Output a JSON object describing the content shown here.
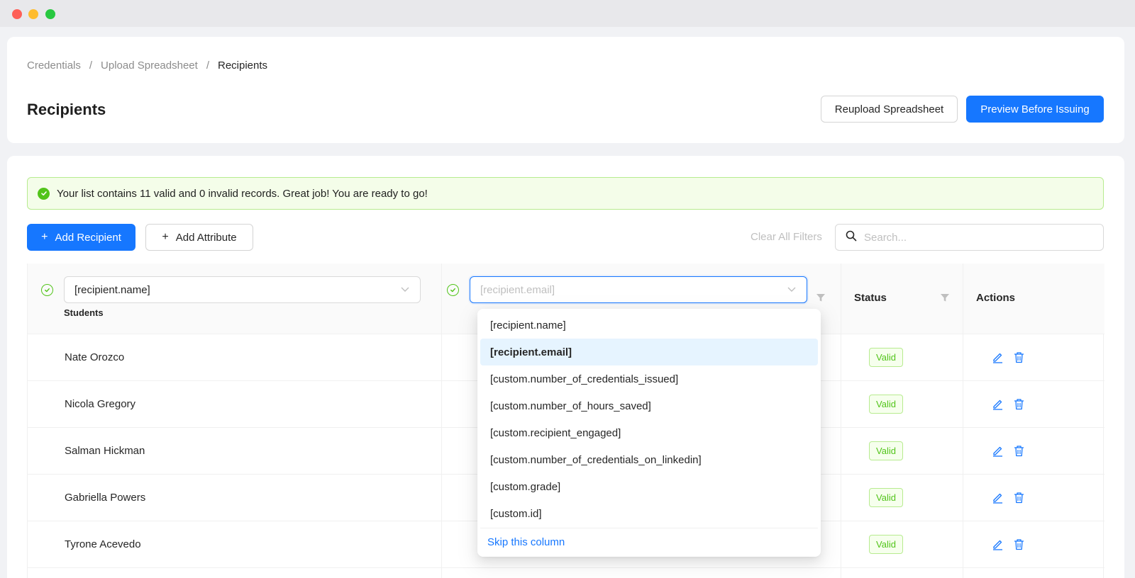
{
  "window": {
    "controls": [
      "close",
      "minimize",
      "zoom"
    ]
  },
  "breadcrumb": {
    "items": [
      "Credentials",
      "Upload Spreadsheet",
      "Recipients"
    ],
    "separator": "/"
  },
  "page": {
    "title": "Recipients"
  },
  "header_buttons": {
    "reupload": "Reupload Spreadsheet",
    "preview": "Preview Before Issuing"
  },
  "alert": {
    "message": "Your list contains 11 valid and 0 invalid records. Great job! You are ready to go!",
    "icon": "check-circle-icon"
  },
  "toolbar": {
    "add_recipient": "Add Recipient",
    "add_attribute": "Add Attribute",
    "plus": "+",
    "clear_filters": "Clear All Filters",
    "search_placeholder": "Search..."
  },
  "table": {
    "col1": {
      "select_value": "[recipient.name]",
      "sublabel": "Students"
    },
    "col2": {
      "select_placeholder": "[recipient.email]"
    },
    "status_header": "Status",
    "actions_header": "Actions",
    "rows": [
      {
        "name": "Nate Orozco",
        "status": "Valid"
      },
      {
        "name": "Nicola Gregory",
        "status": "Valid"
      },
      {
        "name": "Salman Hickman",
        "status": "Valid"
      },
      {
        "name": "Gabriella Powers",
        "status": "Valid"
      },
      {
        "name": "Tyrone Acevedo",
        "status": "Valid"
      }
    ]
  },
  "dropdown": {
    "options": [
      "[recipient.name]",
      "[recipient.email]",
      "[custom.number_of_credentials_issued]",
      "[custom.number_of_hours_saved]",
      "[custom.recipient_engaged]",
      "[custom.number_of_credentials_on_linkedin]",
      "[custom.grade]",
      "[custom.id]"
    ],
    "selected": "[recipient.email]",
    "skip_label": "Skip this column"
  },
  "colors": {
    "primary": "#1677ff",
    "success": "#52c41a",
    "alert_bg": "#f4fde9"
  }
}
